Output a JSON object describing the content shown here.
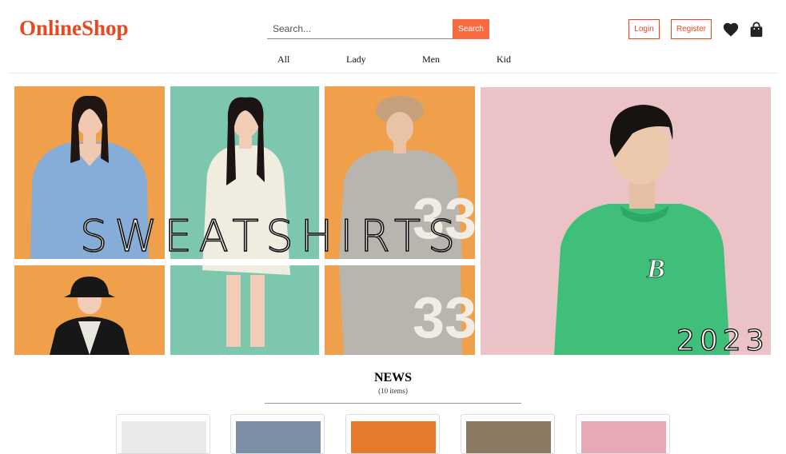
{
  "header": {
    "logo": "OnlineShop",
    "search": {
      "placeholder": "Search...",
      "button_label": "Search"
    },
    "login_label": "Login",
    "register_label": "Register",
    "icons": [
      "heart-icon",
      "bag-icon"
    ]
  },
  "nav": {
    "items": [
      {
        "label": "All"
      },
      {
        "label": "Lady"
      },
      {
        "label": "Men"
      },
      {
        "label": "Kid"
      }
    ]
  },
  "banner": {
    "title": "SWEATSHIRTS",
    "year": "2023"
  },
  "news": {
    "title": "NEWS",
    "count": "(10 items)"
  },
  "colors": {
    "brand": "#e8481f",
    "search_button": "#fa6a41",
    "banner_orange": "#f0a04b",
    "banner_mint": "#7cc7ae",
    "banner_pink": "#ebc3c6",
    "sweatshirt_green": "#3fbf7a"
  }
}
